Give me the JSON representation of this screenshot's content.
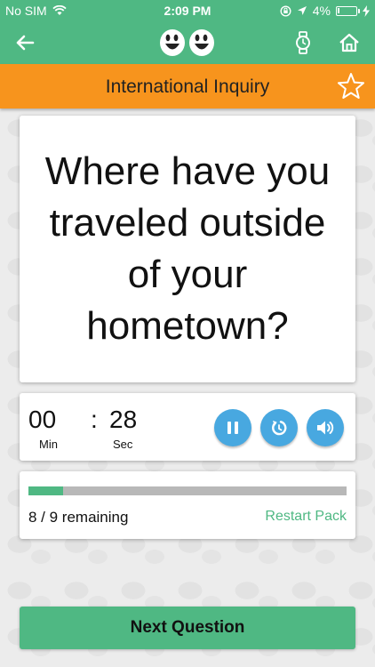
{
  "status_bar": {
    "carrier": "No SIM",
    "time": "2:09 PM",
    "battery": "4%",
    "battery_level": 0.04,
    "icons": [
      "wifi-icon",
      "orientation-lock-icon",
      "location-icon",
      "battery-icon",
      "charging-bolt-icon"
    ]
  },
  "nav": {
    "icons": [
      "back-arrow-icon",
      "smiley-logo",
      "watch-icon",
      "home-icon"
    ]
  },
  "category": {
    "title": "International Inquiry",
    "favorite_icon": "star-outline-icon"
  },
  "question": {
    "text": "Where have you traveled outside of your hometown?"
  },
  "timer": {
    "minutes": "00",
    "minutes_label": "Min",
    "separator": ":",
    "seconds": "28",
    "seconds_label": "Sec",
    "controls": [
      "pause-icon",
      "restart-icon",
      "volume-icon"
    ]
  },
  "progress": {
    "fraction": 0.11,
    "remaining_text": "8 / 9 remaining",
    "restart_label": "Restart Pack"
  },
  "next_button": {
    "label": "Next Question"
  },
  "colors": {
    "primary_green": "#4fb883",
    "orange": "#f7941d",
    "blue": "#48a8e0",
    "track_gray": "#b8b8b8"
  }
}
